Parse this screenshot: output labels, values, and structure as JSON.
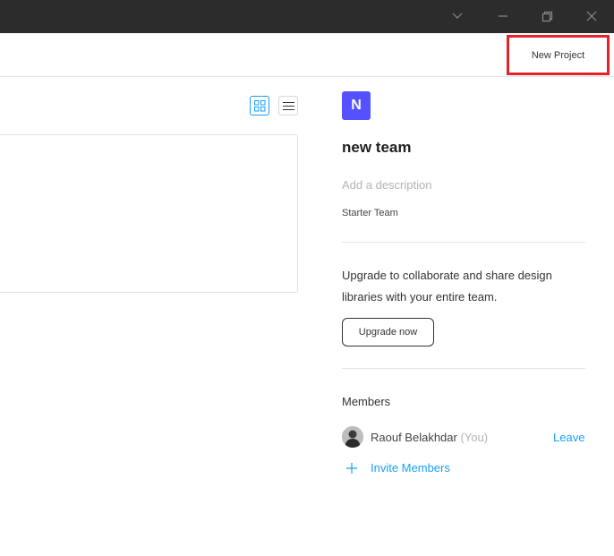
{
  "window": {
    "controls": [
      "chevron-down-icon",
      "minimize-icon",
      "restore-icon",
      "close-icon"
    ]
  },
  "toolbar": {
    "new_project_label": "New Project"
  },
  "view_toggle": {
    "active": "grid"
  },
  "team": {
    "initial": "N",
    "name": "new team",
    "description_placeholder": "Add a description",
    "plan": "Starter Team",
    "avatar_color": "#5551ff"
  },
  "upgrade": {
    "text": "Upgrade to collaborate and share design libraries with your entire team.",
    "button_label": "Upgrade now"
  },
  "members": {
    "title": "Members",
    "list": [
      {
        "name": "Raouf Belakhdar",
        "suffix": "(You)",
        "action": "Leave"
      }
    ],
    "invite_label": "Invite Members"
  },
  "colors": {
    "accent": "#18a0fb",
    "highlight": "#e3222b",
    "titlebar": "#2c2c2c"
  }
}
